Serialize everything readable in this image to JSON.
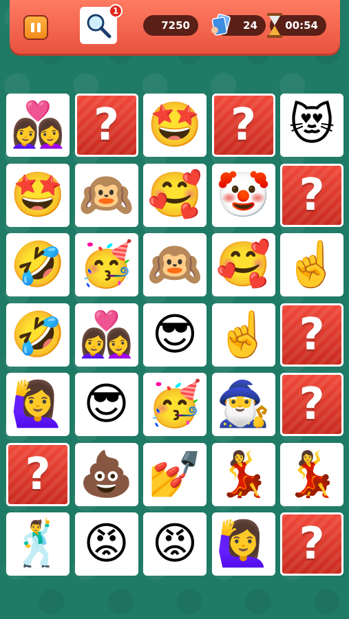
{
  "hud": {
    "hint_count": "1",
    "score": "7250",
    "moves": "24",
    "time": "00:54"
  },
  "colors": {
    "background": "#1f7a66",
    "topbar": "#ef5a44",
    "hidden_tile": "#e23e2f"
  },
  "icons": {
    "pause": "pause-icon",
    "hint": "magnifier-icon",
    "moves": "cards-icon",
    "timer": "hourglass-icon"
  },
  "board": {
    "columns": 5,
    "tiles": [
      {
        "state": "face",
        "emoji": "👩‍❤️‍👩",
        "name": "couple-with-heart"
      },
      {
        "state": "hidden",
        "emoji": "?",
        "name": "hidden"
      },
      {
        "state": "face",
        "emoji": "🤩",
        "name": "star-struck"
      },
      {
        "state": "hidden",
        "emoji": "?",
        "name": "hidden"
      },
      {
        "state": "face",
        "emoji": "😻",
        "name": "heart-eyes-cat"
      },
      {
        "state": "face",
        "emoji": "🤩",
        "name": "star-struck"
      },
      {
        "state": "face",
        "emoji": "🙉",
        "name": "hear-no-evil-monkey"
      },
      {
        "state": "face",
        "emoji": "🥰",
        "name": "smiling-face-with-hearts"
      },
      {
        "state": "face",
        "emoji": "🤡",
        "name": "clown-face"
      },
      {
        "state": "hidden",
        "emoji": "?",
        "name": "hidden"
      },
      {
        "state": "face",
        "emoji": "🤣",
        "name": "rolling-laughing"
      },
      {
        "state": "face",
        "emoji": "🥳",
        "name": "partying-face"
      },
      {
        "state": "face",
        "emoji": "🙉",
        "name": "hear-no-evil-monkey"
      },
      {
        "state": "face",
        "emoji": "🥰",
        "name": "smiling-face-with-hearts"
      },
      {
        "state": "face",
        "emoji": "☝️",
        "name": "index-pointing-up"
      },
      {
        "state": "face",
        "emoji": "🤣",
        "name": "rolling-laughing"
      },
      {
        "state": "face",
        "emoji": "👩‍❤️‍👩",
        "name": "couple-with-heart"
      },
      {
        "state": "face",
        "emoji": "😎",
        "name": "sunglasses-face"
      },
      {
        "state": "face",
        "emoji": "☝️",
        "name": "index-pointing-up"
      },
      {
        "state": "hidden",
        "emoji": "?",
        "name": "hidden"
      },
      {
        "state": "face",
        "emoji": "🙋‍♀️",
        "name": "woman-raising-hand"
      },
      {
        "state": "face",
        "emoji": "😎",
        "name": "sunglasses-face"
      },
      {
        "state": "face",
        "emoji": "🥳",
        "name": "partying-face"
      },
      {
        "state": "face",
        "emoji": "🧙‍♂️",
        "name": "wizard"
      },
      {
        "state": "hidden",
        "emoji": "?",
        "name": "hidden"
      },
      {
        "state": "hidden",
        "emoji": "?",
        "name": "hidden"
      },
      {
        "state": "face",
        "emoji": "💩",
        "name": "pile-of-poo"
      },
      {
        "state": "face",
        "emoji": "💅",
        "name": "nail-polish"
      },
      {
        "state": "face",
        "emoji": "💃",
        "name": "woman-dancing"
      },
      {
        "state": "face",
        "emoji": "💃",
        "name": "woman-dancing"
      },
      {
        "state": "face",
        "emoji": "🕺",
        "name": "man-dancing"
      },
      {
        "state": "face",
        "emoji": "😡",
        "name": "angry-face"
      },
      {
        "state": "face",
        "emoji": "😡",
        "name": "angry-face"
      },
      {
        "state": "face",
        "emoji": "🙋‍♀️",
        "name": "woman-raising-hand"
      },
      {
        "state": "hidden",
        "emoji": "?",
        "name": "hidden"
      }
    ]
  }
}
